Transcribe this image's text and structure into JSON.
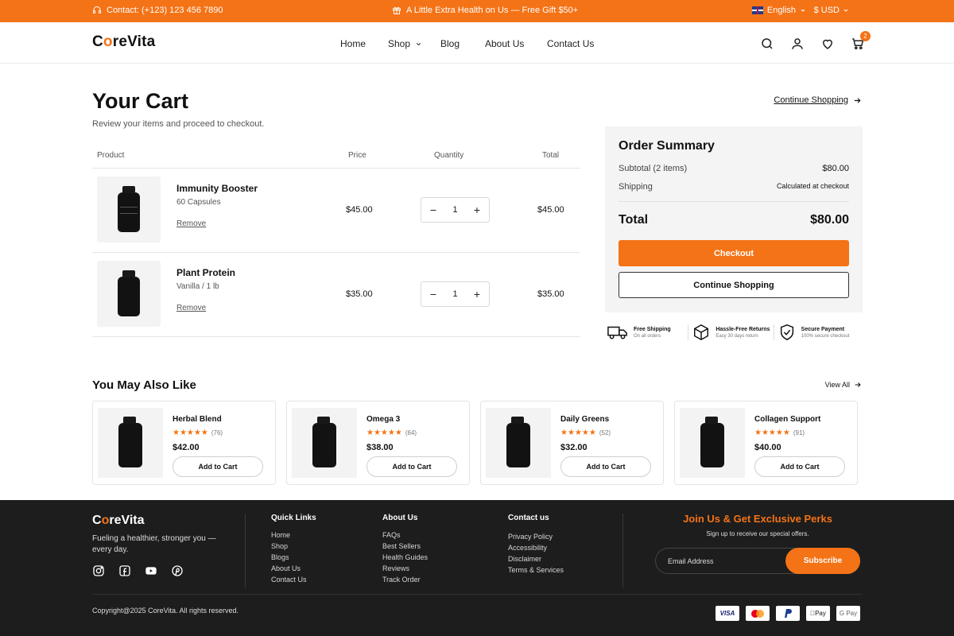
{
  "topbar": {
    "contact": "Contact: (+123) 123 456 7890",
    "promo": "A Little Extra Health on Us — Free Gift $50+",
    "language": "English",
    "currency": "$ USD"
  },
  "header": {
    "logo": "CoreVita",
    "nav": [
      "Home",
      "Shop",
      "Blog",
      "About Us",
      "Contact Us"
    ],
    "cart_count": "2"
  },
  "cart": {
    "title": "Your Cart",
    "subtitle": "Review your items and proceed to checkout.",
    "continue_link": "Continue Shopping",
    "columns": [
      "Product",
      "Price",
      "Quantity",
      "Total"
    ],
    "items": [
      {
        "name": "Immunity Booster",
        "variant": "60 Capsules",
        "remove": "Remove",
        "price": "$45.00",
        "quantity": "1",
        "total": "$45.00"
      },
      {
        "name": "Plant Protein",
        "variant": "Vanilla / 1 lb",
        "remove": "Remove",
        "price": "$35.00",
        "quantity": "1",
        "total": "$35.00"
      }
    ]
  },
  "summary": {
    "title": "Order Summary",
    "subtotal_label": "Subtotal (2 items)",
    "subtotal_value": "$80.00",
    "shipping_label": "Shipping",
    "shipping_value": "Calculated at checkout",
    "total_label": "Total",
    "total_value": "$80.00",
    "checkout": "Checkout",
    "continue": "Continue Shopping"
  },
  "trust": [
    {
      "title": "Free Shipping",
      "sub": "On all orders"
    },
    {
      "title": "Hassle-Free Returns",
      "sub": "Easy 30 days return"
    },
    {
      "title": "Secure Payment",
      "sub": "100% secure checkout"
    }
  ],
  "recommendations": {
    "title": "You May Also Like",
    "view_all": "View All",
    "items": [
      {
        "name": "Herbal Blend",
        "stars": "★★★★★",
        "rating_count": "(76)",
        "price": "$42.00",
        "button": "Add to Cart"
      },
      {
        "name": "Omega 3",
        "stars": "★★★★★",
        "rating_count": "(64)",
        "price": "$38.00",
        "button": "Add to Cart"
      },
      {
        "name": "Daily Greens",
        "stars": "★★★★★",
        "rating_count": "(52)",
        "price": "$32.00",
        "button": "Add to Cart"
      },
      {
        "name": "Collagen Support",
        "stars": "★★★★★",
        "rating_count": "(91)",
        "price": "$40.00",
        "button": "Add to Cart"
      }
    ]
  },
  "footer": {
    "logo": "CoreVita",
    "tagline": "Fueling a healthier, stronger you — every day.",
    "quick_links": {
      "title": "Quick Links",
      "links": [
        "Home",
        "Shop",
        "Blogs",
        "About Us",
        "Contact Us"
      ]
    },
    "about": {
      "title": "About Us",
      "links": [
        "FAQs",
        "Best Sellers",
        "Health Guides",
        "Reviews",
        "Track Order"
      ]
    },
    "contact": {
      "title": "Contact us",
      "links": [
        "Privacy Policy",
        "Accessibility",
        "Disclaimer",
        "Terms & Services"
      ]
    },
    "join_title": "Join Us & Get Exclusive Perks",
    "join_sub": "Sign up to receive our special offers.",
    "email_placeholder": "Email Address",
    "subscribe": "Subscribe",
    "copyright": "Copyright@2025 CoreVita. All rights reserved.",
    "payments": [
      "VISA",
      "Mastercard",
      "PayPal",
      "Apple Pay",
      "G Pay"
    ]
  },
  "colors": {
    "accent": "#f47316",
    "footer_bg": "#1d1d1d",
    "summary_bg": "#f4f4f4"
  }
}
